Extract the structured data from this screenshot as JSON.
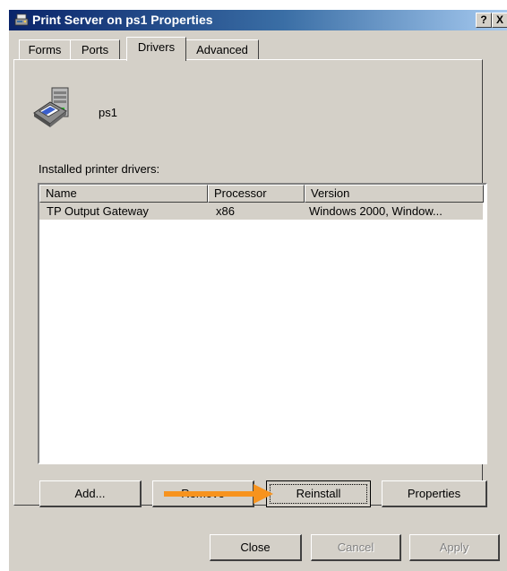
{
  "window": {
    "title": "Print Server on ps1 Properties",
    "help_button": "?",
    "close_button": "X",
    "titlebar_colors": [
      "#0a246a",
      "#a6caf0"
    ]
  },
  "tabs": [
    {
      "label": "Forms",
      "active": false
    },
    {
      "label": "Ports",
      "active": false
    },
    {
      "label": "Drivers",
      "active": true
    },
    {
      "label": "Advanced",
      "active": false
    }
  ],
  "server": {
    "icon": "print-server-icon",
    "name": "ps1"
  },
  "drivers": {
    "label": "Installed printer drivers:",
    "columns": [
      "Name",
      "Processor",
      "Version"
    ],
    "rows": [
      {
        "name": "TP Output Gateway",
        "processor": "x86",
        "version": "Windows 2000, Window...",
        "selected": true
      }
    ]
  },
  "list_buttons": {
    "add": "Add...",
    "remove": "Remove",
    "reinstall": "Reinstall",
    "properties": "Properties"
  },
  "dialog_buttons": {
    "close": "Close",
    "cancel": "Cancel",
    "apply": "Apply"
  },
  "annotation": {
    "arrow_color": "#f7931e",
    "target": "Reinstall"
  }
}
